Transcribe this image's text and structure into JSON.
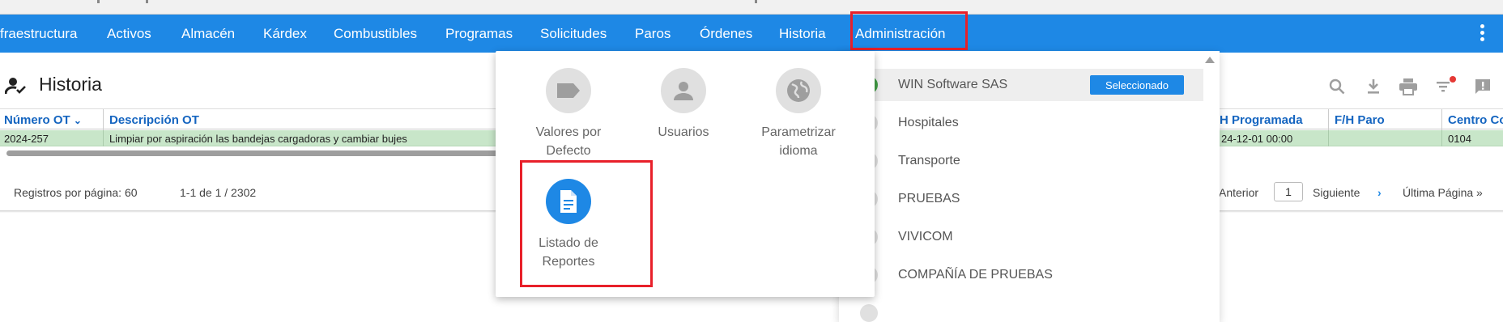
{
  "navbar": {
    "items": [
      "fraestructura",
      "Activos",
      "Almacén",
      "Kárdex",
      "Combustibles",
      "Programas",
      "Solicitudes",
      "Paros",
      "Órdenes",
      "Historia",
      "Administración"
    ],
    "color": "#1e88e5"
  },
  "page": {
    "title": "Historia",
    "icon": "person-check-icon"
  },
  "toolbar": {
    "icons": [
      "search-icon",
      "download-icon",
      "print-icon",
      "filter-icon",
      "feedback-icon"
    ]
  },
  "table": {
    "headers": [
      "Número OT",
      "Descripción OT",
      "H Programada",
      "F/H Paro",
      "Centro Co"
    ],
    "rows": [
      [
        "2024-257",
        "Limpiar por aspiración las bandejas cargadoras y cambiar bujes",
        "24-12-01 00:00",
        "",
        "0104"
      ]
    ],
    "row_color": "#c8e6c9"
  },
  "footer": {
    "records_per_page": "Registros por página: 60",
    "range": "1-1 de 1 / 2302",
    "previous": "Anterior",
    "page_value": "1",
    "next": "Siguiente",
    "last": "Última Página »"
  },
  "admin_menu": {
    "tiles": [
      {
        "label_line1": "Valores por",
        "label_line2": "Defecto",
        "icon": "label-icon"
      },
      {
        "label_line1": "Usuarios",
        "label_line2": "",
        "icon": "user-icon"
      },
      {
        "label_line1": "Parametrizar",
        "label_line2": "idioma",
        "icon": "globe-icon"
      },
      {
        "label_line1": "Listado de",
        "label_line2": "Reportes",
        "icon": "document-icon"
      }
    ]
  },
  "companies": {
    "items": [
      "WIN Software SAS",
      "Hospitales",
      "Transporte",
      "PRUEBAS",
      "VIVICOM",
      "COMPAÑÍA DE PRUEBAS"
    ],
    "selected_label": "Seleccionado"
  },
  "colors": {
    "highlight": "#e8202a",
    "accent": "#1e88e5"
  }
}
